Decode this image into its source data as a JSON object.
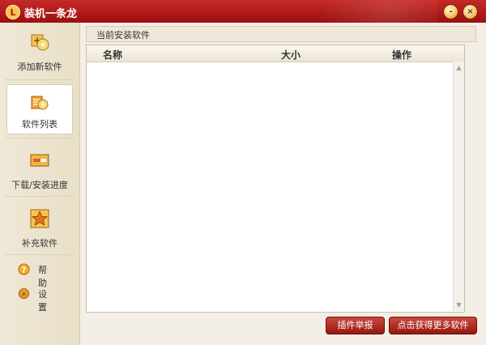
{
  "window": {
    "title": "装机一条龙",
    "logo_letter": "L"
  },
  "controls": {
    "minimize": "-",
    "close": "×"
  },
  "sidebar": {
    "items": [
      {
        "label": "添加新软件"
      },
      {
        "label": "软件列表"
      },
      {
        "label": "下载/安装进度"
      },
      {
        "label": "补充软件"
      }
    ],
    "links": [
      {
        "label": "帮助",
        "icon_glyph": "?"
      },
      {
        "label": "设置",
        "icon_glyph": "✱"
      }
    ]
  },
  "main": {
    "section_title": "当前安装软件",
    "columns": {
      "name": "名称",
      "size": "大小",
      "action": "操作"
    }
  },
  "buttons": {
    "report": "插件举报",
    "more": "点击获得更多软件"
  },
  "colors": {
    "titlebar": "#b31b18",
    "button": "#b3281e"
  }
}
